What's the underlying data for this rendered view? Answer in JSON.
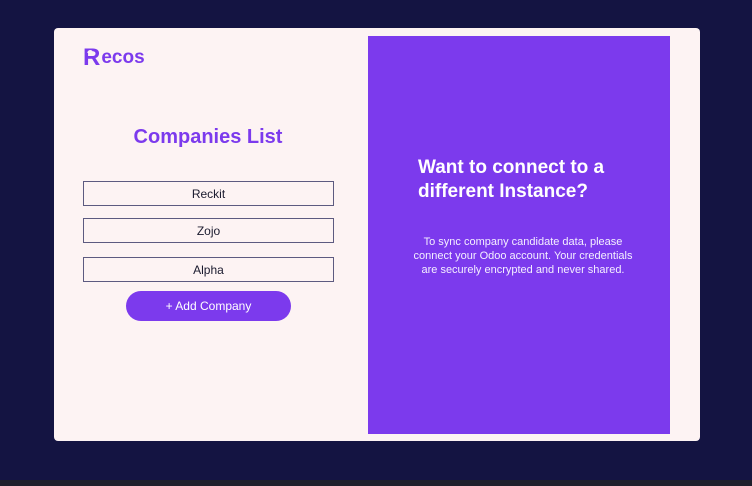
{
  "brand": {
    "logo_initial": "R",
    "logo_rest": "ecos"
  },
  "companies": {
    "title": "Companies List",
    "items": [
      {
        "name": "Reckit"
      },
      {
        "name": "Zojo"
      },
      {
        "name": "Alpha"
      }
    ],
    "add_button_label": "+ Add Company"
  },
  "promo": {
    "heading": "Want to connect to a different Instance?",
    "body": "To sync company candidate data, please connect your Odoo account. Your credentials are securely encrypted and never shared."
  },
  "colors": {
    "page_background": "#141442",
    "card_background": "#fdf3f3",
    "accent": "#7c3aed"
  }
}
